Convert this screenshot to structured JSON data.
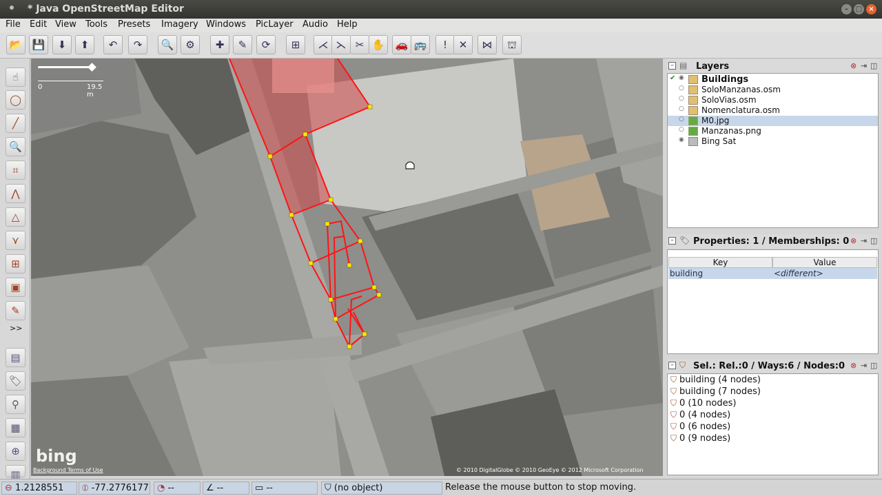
{
  "window": {
    "title": "* Java OpenStreetMap Editor",
    "minimize": "–",
    "maximize": "□",
    "close": "×"
  },
  "menu": [
    "File",
    "Edit",
    "View",
    "Tools",
    "Presets",
    "Imagery",
    "Windows",
    "PicLayer",
    "Audio",
    "Help"
  ],
  "toolbar": {
    "icons": [
      "open-file-icon",
      "save-icon",
      "download-icon",
      "upload-icon",
      "undo-icon",
      "redo-icon",
      "zoom-to-selection-icon",
      "preferences-icon",
      "select-icon",
      "draw-icon",
      "refresh-icon",
      "merge-icon",
      "align-icon",
      "combine-icon",
      "split-icon",
      "hand-icon",
      "car-icon",
      "bus-icon",
      "warning-icon",
      "delete-icon",
      "tool-a-icon",
      "tool-b-icon"
    ],
    "glyphs": [
      "📂",
      "💾",
      "⬇",
      "⬆",
      "↶",
      "↷",
      "🔍",
      "⚙",
      "✚",
      "✎",
      "⟳",
      "⊞",
      "⋌",
      "⋋",
      "✂",
      "✋",
      "🚗",
      "🚌",
      "!",
      "✕",
      "⋈",
      "⛫"
    ]
  },
  "left_tools": {
    "glyphs": [
      "☝",
      "◯",
      "╱",
      "🔍",
      "⌗",
      "⋀",
      "△",
      "⋎",
      "⊞",
      "▣",
      "✎",
      "»",
      "▤",
      "🏷",
      "⚲",
      "▦",
      "⊕",
      "▥"
    ],
    "names": [
      "select-tool-icon",
      "lasso-tool-icon",
      "draw-tool-icon",
      "zoom-tool-icon",
      "delete-tool-icon",
      "improve-way-icon",
      "parallel-tool-icon",
      "extrude-tool-icon",
      "merge-tool-icon",
      "building-tool-icon",
      "pencil-tool-icon",
      "more-tools-icon",
      "toggle-panel-icon",
      "tags-icon",
      "relation-icon",
      "history-icon",
      "add-icon",
      "conflicts-icon"
    ],
    "more_label": ">>"
  },
  "map": {
    "scale": {
      "zero": "0",
      "length": "19.5 m"
    },
    "provider_logo": "bing",
    "terms_link": "Background Terms of Use",
    "copyright": "© 2010 DigitalGlobe © 2010 GeoEye © 2012 Microsoft Corporation",
    "selected_color": "#ff1414",
    "node_color": "#ffe600"
  },
  "layers_panel": {
    "title": "Layers",
    "items": [
      {
        "name": "Buildings",
        "active": true,
        "visible": true,
        "selected": false
      },
      {
        "name": "SoloManzanas.osm",
        "active": false,
        "visible": false,
        "selected": false
      },
      {
        "name": "SoloVias.osm",
        "active": false,
        "visible": false,
        "selected": false
      },
      {
        "name": "Nomenclatura.osm",
        "active": false,
        "visible": false,
        "selected": false
      },
      {
        "name": "M0.jpg",
        "active": false,
        "visible": false,
        "selected": true
      },
      {
        "name": "Manzanas.png",
        "active": false,
        "visible": false,
        "selected": false
      },
      {
        "name": "Bing Sat",
        "active": false,
        "visible": true,
        "selected": false
      }
    ]
  },
  "properties_panel": {
    "title": "Properties: 1 / Memberships: 0",
    "col_key": "Key",
    "col_value": "Value",
    "rows": [
      {
        "key": "building",
        "value": "<different>"
      }
    ]
  },
  "selection_panel": {
    "title": "Sel.: Rel.:0 / Ways:6 / Nodes:0",
    "items": [
      "building (4 nodes)",
      "building (7 nodes)",
      "0 (10 nodes)",
      "0 (4 nodes)",
      "0 (6 nodes)",
      "0 (9 nodes)"
    ]
  },
  "status": {
    "lat": "1.2128551",
    "lon": "-77.2776177",
    "heading": "--",
    "angle": "--",
    "distance": "--",
    "object": "(no object)",
    "message": "Release the mouse button to stop moving."
  }
}
